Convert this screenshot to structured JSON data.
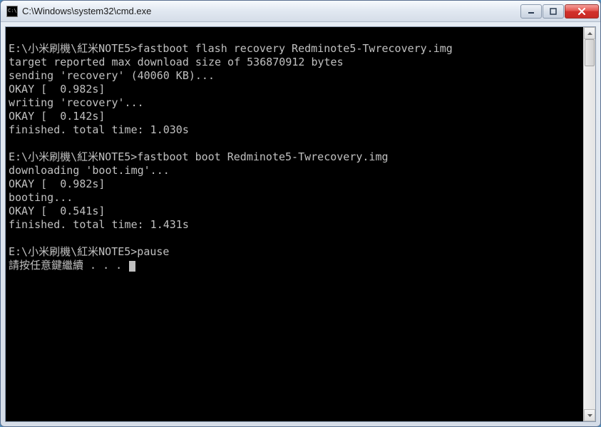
{
  "titlebar": {
    "title": "C:\\Windows\\system32\\cmd.exe"
  },
  "console": {
    "lines": [
      "",
      "E:\\小米刷機\\紅米NOTE5>fastboot flash recovery Redminote5-Twrecovery.img",
      "target reported max download size of 536870912 bytes",
      "sending 'recovery' (40060 KB)...",
      "OKAY [  0.982s]",
      "writing 'recovery'...",
      "OKAY [  0.142s]",
      "finished. total time: 1.030s",
      "",
      "E:\\小米刷機\\紅米NOTE5>fastboot boot Redminote5-Twrecovery.img",
      "downloading 'boot.img'...",
      "OKAY [  0.982s]",
      "booting...",
      "OKAY [  0.541s]",
      "finished. total time: 1.431s",
      "",
      "E:\\小米刷機\\紅米NOTE5>pause"
    ],
    "prompt_continue": "請按任意鍵繼續 . . . "
  }
}
